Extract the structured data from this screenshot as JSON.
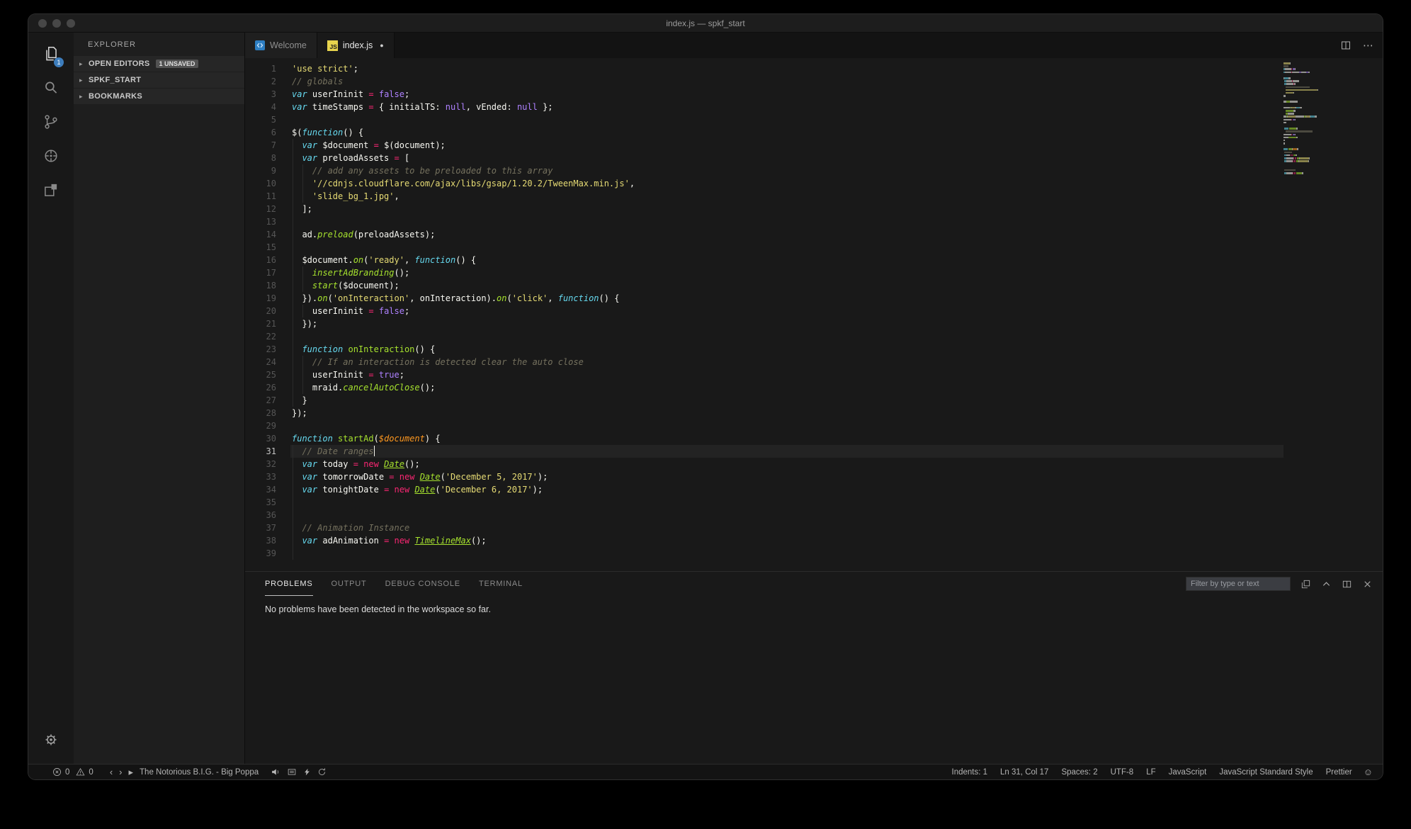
{
  "window": {
    "title": "index.js — spkf_start"
  },
  "colors": {
    "accentBadge": "#3d7dbc",
    "jsIconBg": "#e7d44d",
    "tokens": {
      "c": "#75715e",
      "s": "#e6db74",
      "k": "#f92672",
      "kb": "#66d9ef",
      "f": "#a6e22e",
      "fi": "#a6e22e",
      "p": "#f8f8f2",
      "n": "#ae81ff",
      "prm": "#fd971f",
      "u": "#a6e22e"
    }
  },
  "icons": {
    "prev": "‹",
    "next": "›",
    "play": "▸",
    "dot": "●",
    "ellipsis": "⋯",
    "smiley": "☺",
    "section_arrow": "▸"
  },
  "activity_bar": {
    "explorer_badge": "1"
  },
  "sidebar": {
    "title": "EXPLORER",
    "sections": [
      {
        "label": "OPEN EDITORS",
        "badge": "1 UNSAVED"
      },
      {
        "label": "SPKF_START",
        "badge": ""
      },
      {
        "label": "BOOKMARKS",
        "badge": ""
      }
    ]
  },
  "tabs": [
    {
      "label": "Welcome",
      "icon": "welcome",
      "icon_text": "",
      "active": false,
      "modified": false
    },
    {
      "label": "index.js",
      "icon": "js",
      "icon_text": "JS",
      "active": true,
      "modified": true
    }
  ],
  "editor": {
    "current_line": 31,
    "cursor": {
      "line": 31,
      "col": 17
    },
    "lines": [
      {
        "n": 1,
        "g": 0,
        "t": [
          [
            "s",
            "'use strict'"
          ],
          [
            "p",
            ";"
          ]
        ]
      },
      {
        "n": 2,
        "g": 0,
        "t": [
          [
            "c",
            "// globals"
          ]
        ]
      },
      {
        "n": 3,
        "g": 0,
        "t": [
          [
            "kb",
            "var"
          ],
          [
            "p",
            " userIninit "
          ],
          [
            "k",
            "="
          ],
          [
            "p",
            " "
          ],
          [
            "n",
            "false"
          ],
          [
            "p",
            ";"
          ]
        ]
      },
      {
        "n": 4,
        "g": 0,
        "t": [
          [
            "kb",
            "var"
          ],
          [
            "p",
            " timeStamps "
          ],
          [
            "k",
            "="
          ],
          [
            "p",
            " { initialTS: "
          ],
          [
            "n",
            "null"
          ],
          [
            "p",
            ", vEnded: "
          ],
          [
            "n",
            "null"
          ],
          [
            "p",
            " };"
          ]
        ]
      },
      {
        "n": 5,
        "g": 0,
        "t": []
      },
      {
        "n": 6,
        "g": 0,
        "t": [
          [
            "p",
            "$("
          ],
          [
            "kb",
            "function"
          ],
          [
            "p",
            "() {"
          ]
        ]
      },
      {
        "n": 7,
        "g": 2,
        "t": [
          [
            "p",
            "  "
          ],
          [
            "kb",
            "var"
          ],
          [
            "p",
            " $document "
          ],
          [
            "k",
            "="
          ],
          [
            "p",
            " $(document);"
          ]
        ]
      },
      {
        "n": 8,
        "g": 2,
        "t": [
          [
            "p",
            "  "
          ],
          [
            "kb",
            "var"
          ],
          [
            "p",
            " preloadAssets "
          ],
          [
            "k",
            "="
          ],
          [
            "p",
            " ["
          ]
        ]
      },
      {
        "n": 9,
        "g": 4,
        "t": [
          [
            "p",
            "    "
          ],
          [
            "c",
            "// add any assets to be preloaded to this array"
          ]
        ]
      },
      {
        "n": 10,
        "g": 4,
        "t": [
          [
            "p",
            "    "
          ],
          [
            "s",
            "'//cdnjs.cloudflare.com/ajax/libs/gsap/1.20.2/TweenMax.min.js'"
          ],
          [
            "p",
            ","
          ]
        ]
      },
      {
        "n": 11,
        "g": 4,
        "t": [
          [
            "p",
            "    "
          ],
          [
            "s",
            "'slide_bg_1.jpg'"
          ],
          [
            "p",
            ","
          ]
        ]
      },
      {
        "n": 12,
        "g": 2,
        "t": [
          [
            "p",
            "  ];"
          ]
        ]
      },
      {
        "n": 13,
        "g": 2,
        "t": []
      },
      {
        "n": 14,
        "g": 2,
        "t": [
          [
            "p",
            "  ad."
          ],
          [
            "fi",
            "preload"
          ],
          [
            "p",
            "(preloadAssets);"
          ]
        ]
      },
      {
        "n": 15,
        "g": 2,
        "t": []
      },
      {
        "n": 16,
        "g": 2,
        "t": [
          [
            "p",
            "  $document."
          ],
          [
            "fi",
            "on"
          ],
          [
            "p",
            "("
          ],
          [
            "s",
            "'ready'"
          ],
          [
            "p",
            ", "
          ],
          [
            "kb",
            "function"
          ],
          [
            "p",
            "() {"
          ]
        ]
      },
      {
        "n": 17,
        "g": 4,
        "t": [
          [
            "p",
            "    "
          ],
          [
            "fi",
            "insertAdBranding"
          ],
          [
            "p",
            "();"
          ]
        ]
      },
      {
        "n": 18,
        "g": 4,
        "t": [
          [
            "p",
            "    "
          ],
          [
            "fi",
            "start"
          ],
          [
            "p",
            "($document);"
          ]
        ]
      },
      {
        "n": 19,
        "g": 2,
        "t": [
          [
            "p",
            "  })."
          ],
          [
            "fi",
            "on"
          ],
          [
            "p",
            "("
          ],
          [
            "s",
            "'onInteraction'"
          ],
          [
            "p",
            ", onInteraction)."
          ],
          [
            "fi",
            "on"
          ],
          [
            "p",
            "("
          ],
          [
            "s",
            "'click'"
          ],
          [
            "p",
            ", "
          ],
          [
            "kb",
            "function"
          ],
          [
            "p",
            "() {"
          ]
        ]
      },
      {
        "n": 20,
        "g": 4,
        "t": [
          [
            "p",
            "    userIninit "
          ],
          [
            "k",
            "="
          ],
          [
            "p",
            " "
          ],
          [
            "n",
            "false"
          ],
          [
            "p",
            ";"
          ]
        ]
      },
      {
        "n": 21,
        "g": 2,
        "t": [
          [
            "p",
            "  });"
          ]
        ]
      },
      {
        "n": 22,
        "g": 2,
        "t": []
      },
      {
        "n": 23,
        "g": 2,
        "t": [
          [
            "p",
            "  "
          ],
          [
            "kb",
            "function"
          ],
          [
            "p",
            " "
          ],
          [
            "f",
            "onInteraction"
          ],
          [
            "p",
            "() {"
          ]
        ]
      },
      {
        "n": 24,
        "g": 4,
        "t": [
          [
            "p",
            "    "
          ],
          [
            "c",
            "// If an interaction is detected clear the auto close"
          ]
        ]
      },
      {
        "n": 25,
        "g": 4,
        "t": [
          [
            "p",
            "    userIninit "
          ],
          [
            "k",
            "="
          ],
          [
            "p",
            " "
          ],
          [
            "n",
            "true"
          ],
          [
            "p",
            ";"
          ]
        ]
      },
      {
        "n": 26,
        "g": 4,
        "t": [
          [
            "p",
            "    mraid."
          ],
          [
            "fi",
            "cancelAutoClose"
          ],
          [
            "p",
            "();"
          ]
        ]
      },
      {
        "n": 27,
        "g": 2,
        "t": [
          [
            "p",
            "  }"
          ]
        ]
      },
      {
        "n": 28,
        "g": 0,
        "t": [
          [
            "p",
            "});"
          ]
        ]
      },
      {
        "n": 29,
        "g": 0,
        "t": []
      },
      {
        "n": 30,
        "g": 0,
        "t": [
          [
            "kb",
            "function"
          ],
          [
            "p",
            " "
          ],
          [
            "f",
            "startAd"
          ],
          [
            "p",
            "("
          ],
          [
            "prm",
            "$document"
          ],
          [
            "p",
            ") {"
          ]
        ]
      },
      {
        "n": 31,
        "g": 2,
        "t": [
          [
            "p",
            "  "
          ],
          [
            "c",
            "// Date ranges"
          ]
        ]
      },
      {
        "n": 32,
        "g": 2,
        "t": [
          [
            "p",
            "  "
          ],
          [
            "kb",
            "var"
          ],
          [
            "p",
            " today "
          ],
          [
            "k",
            "="
          ],
          [
            "p",
            " "
          ],
          [
            "k",
            "new"
          ],
          [
            "p",
            " "
          ],
          [
            "u",
            "Date"
          ],
          [
            "p",
            "();"
          ]
        ]
      },
      {
        "n": 33,
        "g": 2,
        "t": [
          [
            "p",
            "  "
          ],
          [
            "kb",
            "var"
          ],
          [
            "p",
            " tomorrowDate "
          ],
          [
            "k",
            "="
          ],
          [
            "p",
            " "
          ],
          [
            "k",
            "new"
          ],
          [
            "p",
            " "
          ],
          [
            "u",
            "Date"
          ],
          [
            "p",
            "("
          ],
          [
            "s",
            "'December 5, 2017'"
          ],
          [
            "p",
            ");"
          ]
        ]
      },
      {
        "n": 34,
        "g": 2,
        "t": [
          [
            "p",
            "  "
          ],
          [
            "kb",
            "var"
          ],
          [
            "p",
            " tonightDate "
          ],
          [
            "k",
            "="
          ],
          [
            "p",
            " "
          ],
          [
            "k",
            "new"
          ],
          [
            "p",
            " "
          ],
          [
            "u",
            "Date"
          ],
          [
            "p",
            "("
          ],
          [
            "s",
            "'December 6, 2017'"
          ],
          [
            "p",
            ");"
          ]
        ]
      },
      {
        "n": 35,
        "g": 2,
        "t": []
      },
      {
        "n": 36,
        "g": 2,
        "t": []
      },
      {
        "n": 37,
        "g": 2,
        "t": [
          [
            "p",
            "  "
          ],
          [
            "c",
            "// Animation Instance"
          ]
        ]
      },
      {
        "n": 38,
        "g": 2,
        "t": [
          [
            "p",
            "  "
          ],
          [
            "kb",
            "var"
          ],
          [
            "p",
            " adAnimation "
          ],
          [
            "k",
            "="
          ],
          [
            "p",
            " "
          ],
          [
            "k",
            "new"
          ],
          [
            "p",
            " "
          ],
          [
            "u",
            "TimelineMax"
          ],
          [
            "p",
            "();"
          ]
        ]
      },
      {
        "n": 39,
        "g": 2,
        "t": []
      }
    ]
  },
  "panel": {
    "tabs": [
      "PROBLEMS",
      "OUTPUT",
      "DEBUG CONSOLE",
      "TERMINAL"
    ],
    "active_tab": "PROBLEMS",
    "filter_placeholder": "Filter by type or text",
    "message": "No problems have been detected in the workspace so far."
  },
  "status_bar": {
    "errors": "0",
    "warnings": "0",
    "track": "The Notorious B.I.G. - Big Poppa",
    "right": [
      "Indents: 1",
      "Ln 31, Col 17",
      "Spaces: 2",
      "UTF-8",
      "LF",
      "JavaScript",
      "JavaScript Standard Style",
      "Prettier"
    ]
  }
}
